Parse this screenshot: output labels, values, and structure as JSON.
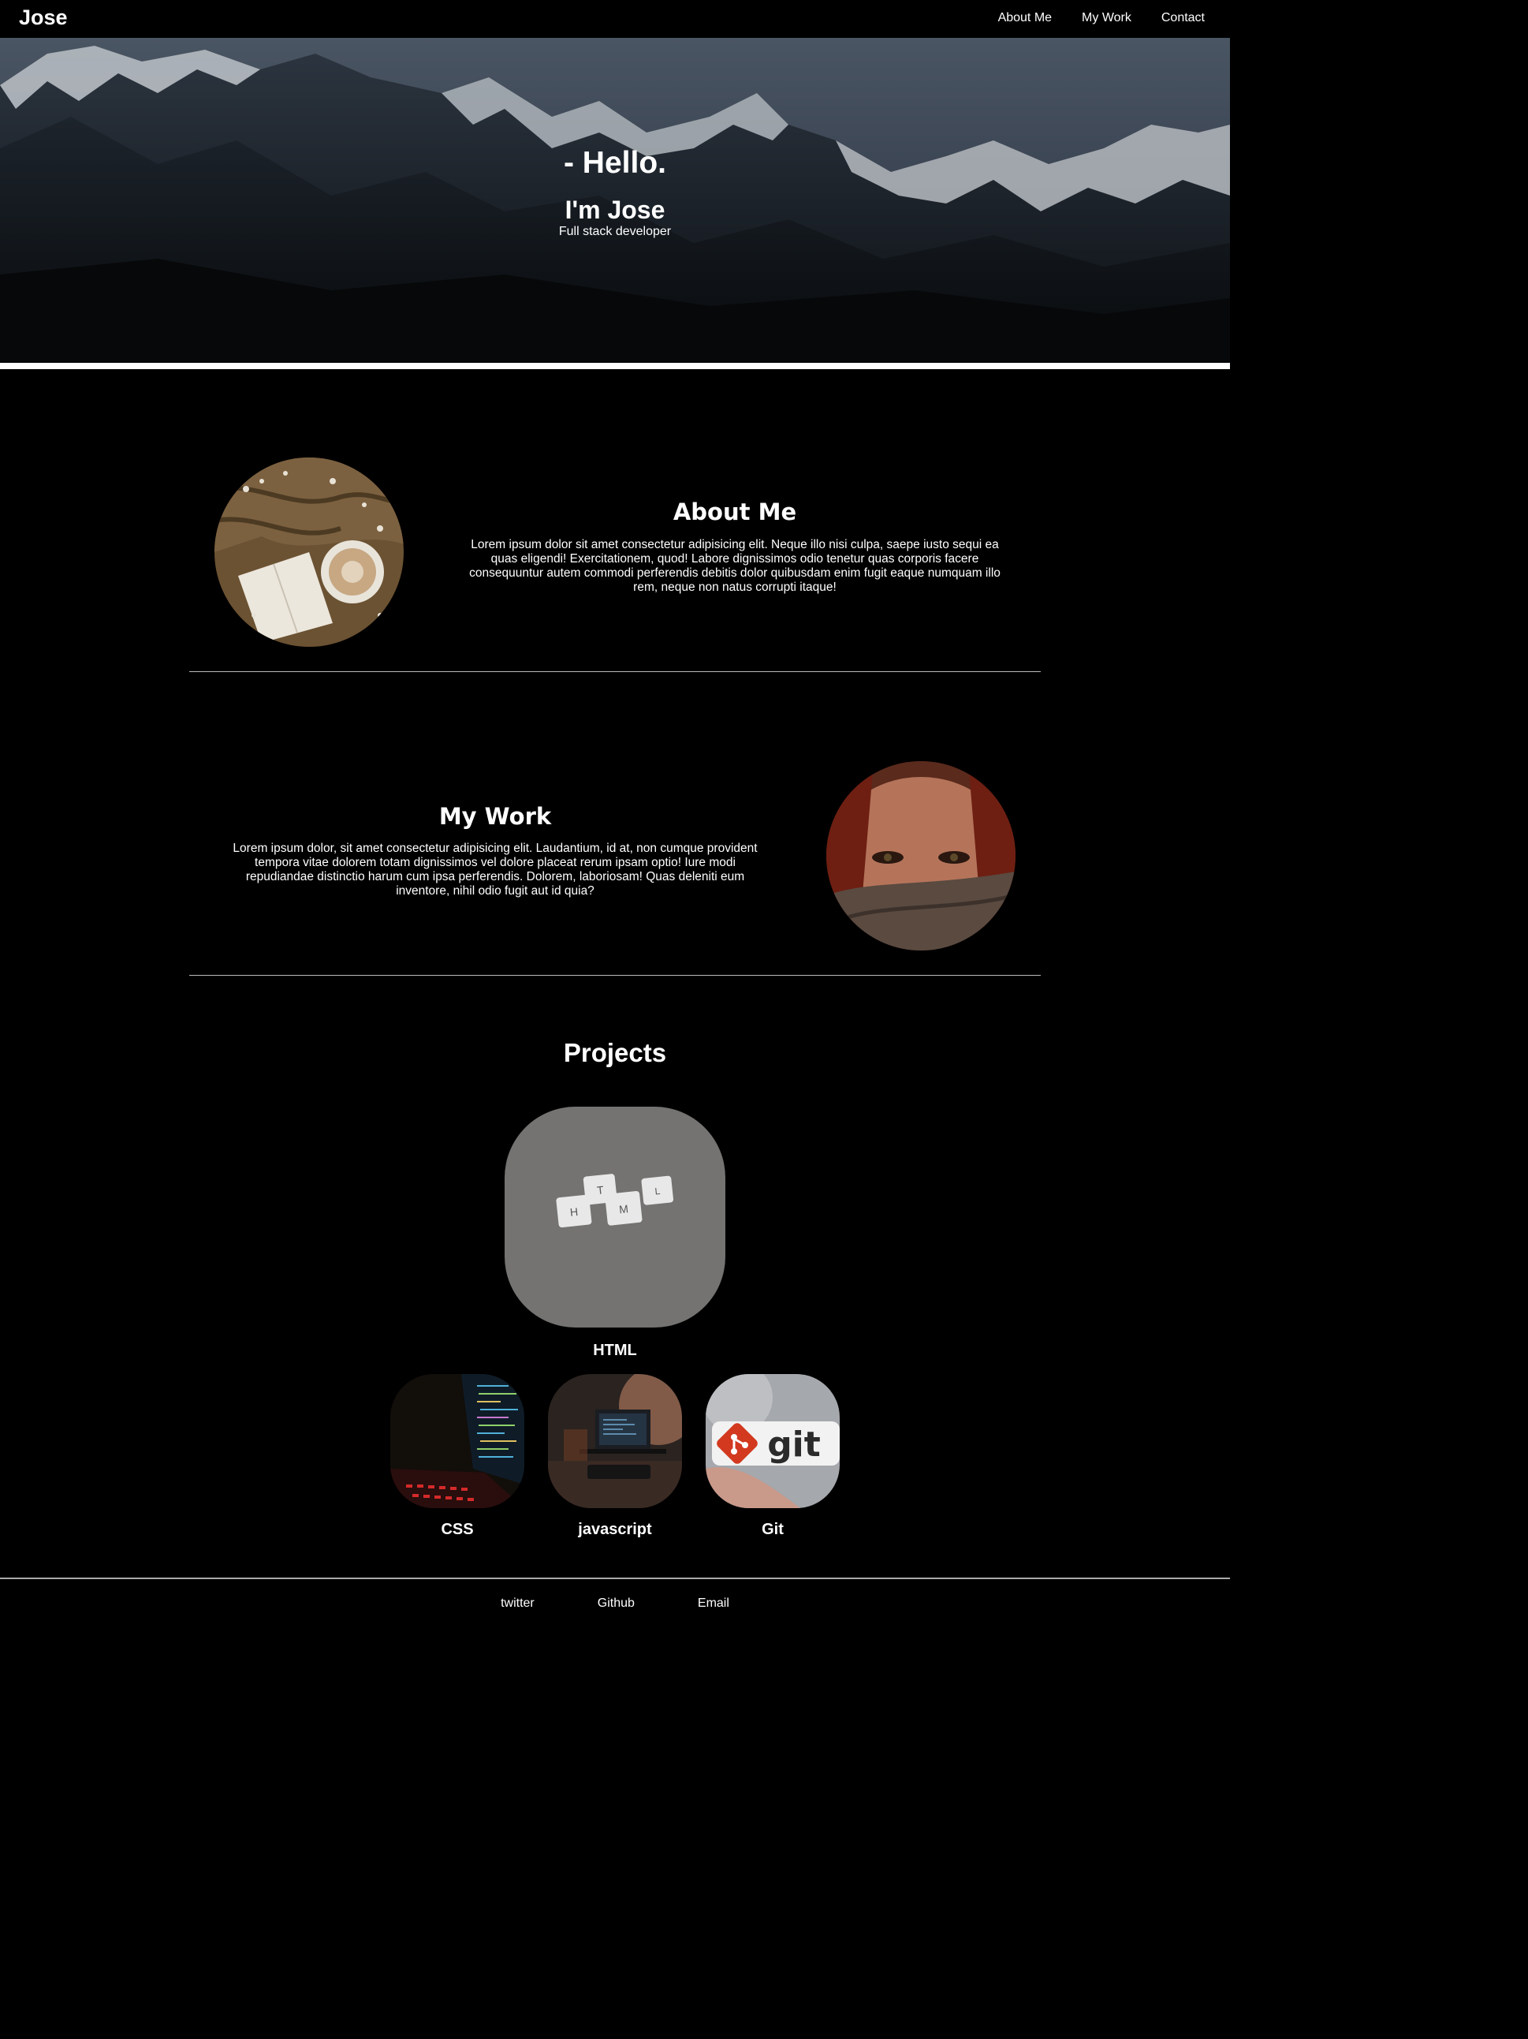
{
  "nav": {
    "brand": "Jose",
    "links": [
      "About Me",
      "My Work",
      "Contact"
    ]
  },
  "hero": {
    "greeting": "- Hello.",
    "name": "I'm Jose",
    "role": "Full stack developer"
  },
  "about": {
    "title": "About Me",
    "text": "Lorem ipsum dolor sit amet consectetur adipisicing elit. Neque illo nisi culpa, saepe iusto sequi ea quas eligendi! Exercitationem, quod! Labore dignissimos odio tenetur quas corporis facere consequuntur autem commodi perferendis debitis dolor quibusdam enim fugit eaque numquam illo rem, neque non natus corrupti itaque!"
  },
  "work": {
    "title": "My Work",
    "text": "Lorem ipsum dolor, sit amet consectetur adipisicing elit. Laudantium, id at, non cumque provident tempora vitae dolorem totam dignissimos vel dolore placeat rerum ipsam optio! Iure modi repudiandae distinctio harum cum ipsa perferendis. Dolorem, laboriosam! Quas deleniti eum inventore, nihil odio fugit aut id quia?"
  },
  "projects": {
    "title": "Projects",
    "items": [
      {
        "label": "HTML"
      },
      {
        "label": "CSS"
      },
      {
        "label": "javascript"
      },
      {
        "label": "Git"
      }
    ],
    "tile_letters": [
      "H",
      "T",
      "M",
      "L"
    ],
    "git_logo_text": "git"
  },
  "footer": {
    "links": [
      "twitter",
      "Github",
      "Email"
    ]
  },
  "colors": {
    "background": "#000000",
    "text": "#ffffff",
    "divider": "#bbbbbb",
    "git_red": "#d2391f"
  }
}
